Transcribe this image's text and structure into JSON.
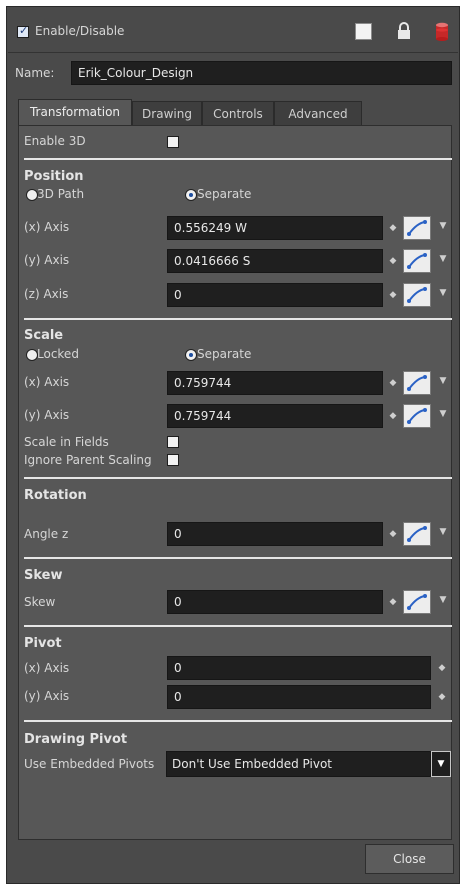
{
  "header": {
    "enable_label": "Enable/Disable",
    "enabled": true
  },
  "name_row": {
    "label": "Name:",
    "value": "Erik_Colour_Design"
  },
  "tabs": [
    {
      "label": "Transformation",
      "active": true
    },
    {
      "label": "Drawing",
      "active": false
    },
    {
      "label": "Controls",
      "active": false
    },
    {
      "label": "Advanced",
      "active": false
    }
  ],
  "enable3d": {
    "label": "Enable 3D",
    "checked": false
  },
  "position": {
    "title": "Position",
    "mode_3dpath": "3D Path",
    "mode_separate": "Separate",
    "selected_mode": "Separate",
    "x": {
      "label": "(x) Axis",
      "value": "0.556249 W"
    },
    "y": {
      "label": "(y) Axis",
      "value": "0.0416666 S"
    },
    "z": {
      "label": "(z) Axis",
      "value": "0"
    }
  },
  "scale": {
    "title": "Scale",
    "mode_locked": "Locked",
    "mode_separate": "Separate",
    "selected_mode": "Separate",
    "x": {
      "label": "(x) Axis",
      "value": "0.759744"
    },
    "y": {
      "label": "(y) Axis",
      "value": "0.759744"
    },
    "scale_in_fields": {
      "label": "Scale in Fields",
      "checked": false
    },
    "ignore_parent": {
      "label": "Ignore Parent Scaling",
      "checked": false
    }
  },
  "rotation": {
    "title": "Rotation",
    "angle": {
      "label": "Angle z",
      "value": "0"
    }
  },
  "skew": {
    "title": "Skew",
    "field": {
      "label": "Skew",
      "value": "0"
    }
  },
  "pivot": {
    "title": "Pivot",
    "x": {
      "label": "(x) Axis",
      "value": "0"
    },
    "y": {
      "label": "(y) Axis",
      "value": "0"
    }
  },
  "drawing_pivot": {
    "title": "Drawing Pivot",
    "label": "Use Embedded Pivots",
    "selected": "Don't Use Embedded Pivot"
  },
  "footer": {
    "close_label": "Close"
  }
}
